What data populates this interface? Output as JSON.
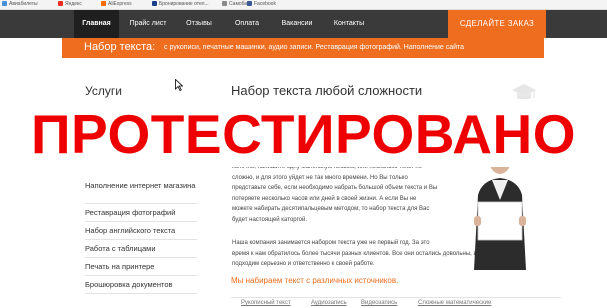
{
  "bookmarks": [
    {
      "label": "Авиабилеты",
      "icon": "plane-icon",
      "color": "#4a90d9"
    },
    {
      "label": "Яндекс",
      "icon": "yandex-icon",
      "color": "#e62d1f"
    },
    {
      "label": "AliExpress",
      "icon": "aliexpress-icon",
      "color": "#ff6a00"
    },
    {
      "label": "Бронирование отел...",
      "icon": "booking-icon",
      "color": "#1b3f8f"
    },
    {
      "label": "Самоба",
      "icon": "bookmark-icon",
      "color": "#8a8a8a"
    },
    {
      "label": "Facebook",
      "icon": "facebook-icon",
      "color": "#3b5998"
    }
  ],
  "nav": {
    "items": [
      "Главная",
      "Прайс лист",
      "Отзывы",
      "Оплата",
      "Вакансии",
      "Контакты"
    ],
    "order_button": "СДЕЛАЙТЕ ЗАКАЗ"
  },
  "tagline": {
    "title": "Набор текста:",
    "text": "с рукописи, печатные машинки, аудио записи. Реставрация фотографий. Наполнение сайта"
  },
  "sidebar": {
    "title": "Услуги",
    "items": [
      "Наполнение интернет магазина",
      "Реставрация фотографий",
      "Набор английского текста",
      "Работа с таблицами",
      "Печать на принтере",
      "Брошюровка документов"
    ]
  },
  "main": {
    "title": "Набор текста любой сложности",
    "paragraph1_lines": [
      "конечно, напишите одну маленькую письмо, или несколько текст не",
      "сложно, и для этого уйдет не так много времени. Но Вы только",
      "представьте себе, если необходимо набрать большой объем текста и Вы",
      "потеряете несколько часов или дней в своей жизни. А если Вы не",
      "можете набирать десятипальцевым методом, то набор текста для Вас",
      "будет настоящей каторгой."
    ],
    "paragraph2_lines": [
      "Наша компания занимается набором текста уже не первый год. За это",
      "время к нам обратилось более тысячи разных клиентов. Все они остались довольны, ведь мы",
      "подходим серьезно и ответственно к своей работе."
    ],
    "subtitle": "Мы набираем текст с различных источников.",
    "tabs": [
      "Рукописный текст",
      "Аудиозапись",
      "Видеозапись",
      "Сложные математические"
    ]
  },
  "watermark": {
    "text": "ПРОТЕСТИРОВАНО",
    "color": "#ee0000"
  },
  "colors": {
    "accent": "#ef6d1f",
    "nav_bg": "#3a3a3a"
  }
}
